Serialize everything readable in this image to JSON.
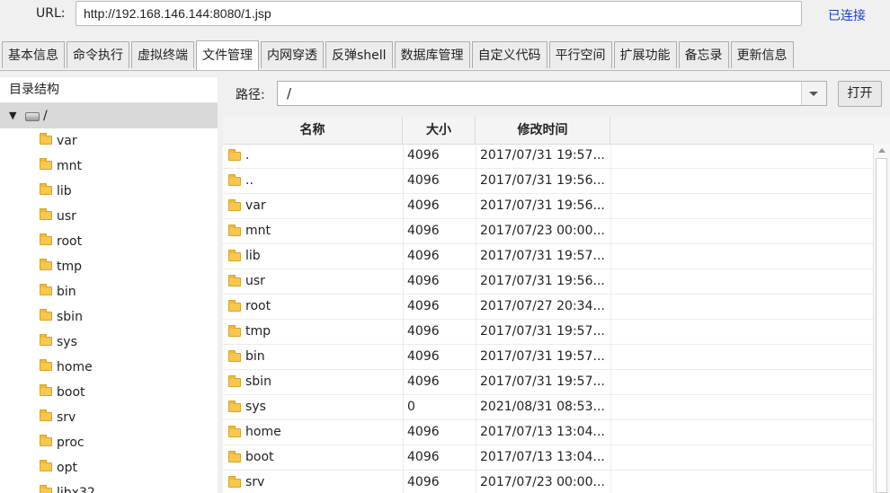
{
  "url": {
    "label": "URL:",
    "value": "http://192.168.146.144:8080/1.jsp",
    "status": "已连接"
  },
  "tabs": [
    "基本信息",
    "命令执行",
    "虚拟终端",
    "文件管理",
    "内网穿透",
    "反弹shell",
    "数据库管理",
    "自定义代码",
    "平行空间",
    "扩展功能",
    "备忘录",
    "更新信息"
  ],
  "active_tab": "文件管理",
  "tree": {
    "header": "目录结构",
    "root": "/",
    "items": [
      "var",
      "mnt",
      "lib",
      "usr",
      "root",
      "tmp",
      "bin",
      "sbin",
      "sys",
      "home",
      "boot",
      "srv",
      "proc",
      "opt",
      "libx32"
    ]
  },
  "path": {
    "label": "路径:",
    "value": "/",
    "open_button": "打开"
  },
  "file_table": {
    "headers": {
      "name": "名称",
      "size": "大小",
      "mtime": "修改时间"
    },
    "rows": [
      {
        "name": ".",
        "size": "4096",
        "mtime": "2017/07/31 19:57..."
      },
      {
        "name": "..",
        "size": "4096",
        "mtime": "2017/07/31 19:56..."
      },
      {
        "name": "var",
        "size": "4096",
        "mtime": "2017/07/31 19:56..."
      },
      {
        "name": "mnt",
        "size": "4096",
        "mtime": "2017/07/23 00:00..."
      },
      {
        "name": "lib",
        "size": "4096",
        "mtime": "2017/07/31 19:57..."
      },
      {
        "name": "usr",
        "size": "4096",
        "mtime": "2017/07/31 19:56..."
      },
      {
        "name": "root",
        "size": "4096",
        "mtime": "2017/07/27 20:34..."
      },
      {
        "name": "tmp",
        "size": "4096",
        "mtime": "2017/07/31 19:57..."
      },
      {
        "name": "bin",
        "size": "4096",
        "mtime": "2017/07/31 19:57..."
      },
      {
        "name": "sbin",
        "size": "4096",
        "mtime": "2017/07/31 19:57..."
      },
      {
        "name": "sys",
        "size": "0",
        "mtime": "2021/08/31 08:53..."
      },
      {
        "name": "home",
        "size": "4096",
        "mtime": "2017/07/13 13:04..."
      },
      {
        "name": "boot",
        "size": "4096",
        "mtime": "2017/07/13 13:04..."
      },
      {
        "name": "srv",
        "size": "4096",
        "mtime": "2017/07/23 00:00..."
      }
    ]
  },
  "colors": {
    "status_link": "#1a3fc9",
    "folder": "#f7c74f",
    "tree_selected": "#d9d9d9"
  }
}
